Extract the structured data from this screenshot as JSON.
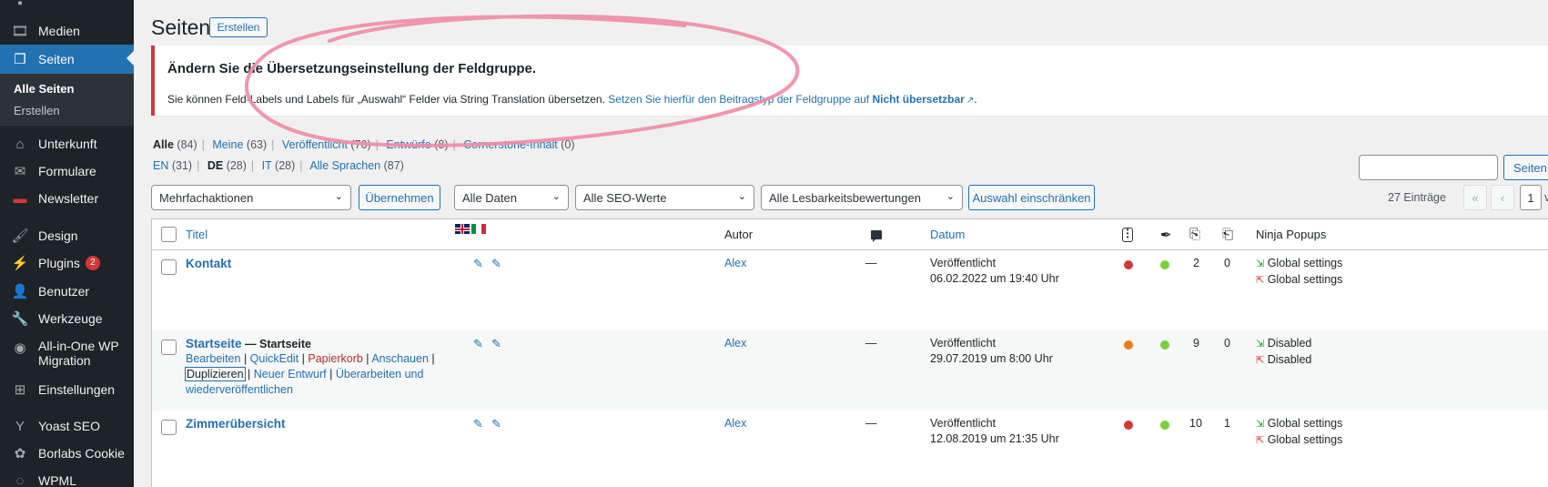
{
  "sidebar": {
    "items": [
      {
        "label": "Medien",
        "icon": "media-icon"
      },
      {
        "label": "Seiten",
        "icon": "pages-icon"
      },
      {
        "label": "Unterkunft",
        "icon": "home-icon"
      },
      {
        "label": "Formulare",
        "icon": "mail-icon"
      },
      {
        "label": "Newsletter",
        "icon": "newsletter-icon"
      },
      {
        "label": "Design",
        "icon": "brush-icon"
      },
      {
        "label": "Plugins",
        "icon": "plugin-icon",
        "badge": "2"
      },
      {
        "label": "Benutzer",
        "icon": "user-icon"
      },
      {
        "label": "Werkzeuge",
        "icon": "wrench-icon"
      },
      {
        "label": "All-in-One WP",
        "label2": "Migration",
        "icon": "migration-icon"
      },
      {
        "label": "Einstellungen",
        "icon": "settings-icon"
      },
      {
        "label": "Yoast SEO",
        "icon": "yoast-icon"
      },
      {
        "label": "Borlabs Cookie",
        "icon": "cookie-icon"
      },
      {
        "label": "WPML",
        "icon": "wpml-icon"
      }
    ],
    "submenu": [
      "Alle Seiten",
      "Erstellen"
    ]
  },
  "header": {
    "title": "Seiten",
    "add_button": "Erstellen"
  },
  "notice": {
    "title": "Ändern Sie die Übersetzungseinstellung der Feldgruppe.",
    "text": "Sie können Feld-Labels und Labels für „Auswahl“ Felder via String Translation übersetzen.",
    "link_text": "Setzen Sie hierfür den Beitragstyp der Feldgruppe auf",
    "link_bold": "Nicht übersetzbar",
    "link_end": "."
  },
  "status_filters": [
    {
      "label": "Alle",
      "count": "(84)"
    },
    {
      "label": "Meine",
      "count": "(63)"
    },
    {
      "label": "Veröffentlicht",
      "count": "(76)"
    },
    {
      "label": "Entwürfe",
      "count": "(8)"
    },
    {
      "label": "Cornerstone-Inhalt",
      "count": "(0)"
    }
  ],
  "language_filters": [
    {
      "label": "EN",
      "count": "(31)"
    },
    {
      "label": "DE",
      "count": "(28)"
    },
    {
      "label": "IT",
      "count": "(28)"
    },
    {
      "label": "Alle Sprachen",
      "count": "(87)"
    }
  ],
  "search_button": "Seiten d",
  "toolbar": {
    "bulk_actions": "Mehrfachaktionen",
    "apply": "Übernehmen",
    "dates": "Alle Daten",
    "seo": "Alle SEO-Werte",
    "readability": "Alle Lesbarkeitsbewertungen",
    "filter": "Auswahl einschränken",
    "count": "27 Einträge",
    "page": "1",
    "of": "vo"
  },
  "columns": {
    "title": "Titel",
    "author": "Autor",
    "date": "Datum",
    "popups": "Ninja Popups"
  },
  "rows": [
    {
      "title": "Kontakt",
      "suffix": "",
      "author": "Alex",
      "status": "Veröffentlicht",
      "date": "06.02.2022 um 19:40 Uhr",
      "seo_color": "#d63638",
      "read_color": "#7ad03a",
      "links_in": "2",
      "links_out": "0",
      "popup_in": "Global settings",
      "popup_out": "Global settings"
    },
    {
      "title": "Startseite",
      "suffix": "— Startseite",
      "author": "Alex",
      "status": "Veröffentlicht",
      "date": "29.07.2019 um 8:00 Uhr",
      "seo_color": "#ee7c1b",
      "read_color": "#7ad03a",
      "links_in": "9",
      "links_out": "0",
      "popup_in": "Disabled",
      "popup_out": "Disabled",
      "actions": {
        "edit": "Bearbeiten",
        "quickedit": "QuickEdit",
        "trash": "Papierkorb",
        "view": "Anschauen",
        "duplicate": "Duplizieren",
        "new_draft": "Neuer Entwurf",
        "rewrite": "Überarbeiten und",
        "rewrite2": "wiederveröffentlichen"
      }
    },
    {
      "title": "Zimmerübersicht",
      "suffix": "",
      "author": "Alex",
      "status": "Veröffentlicht",
      "date": "12.08.2019 um 21:35 Uhr",
      "seo_color": "#d63638",
      "read_color": "#7ad03a",
      "links_in": "10",
      "links_out": "1",
      "popup_in": "Global settings",
      "popup_out": "Global settings"
    }
  ],
  "dash": "—"
}
